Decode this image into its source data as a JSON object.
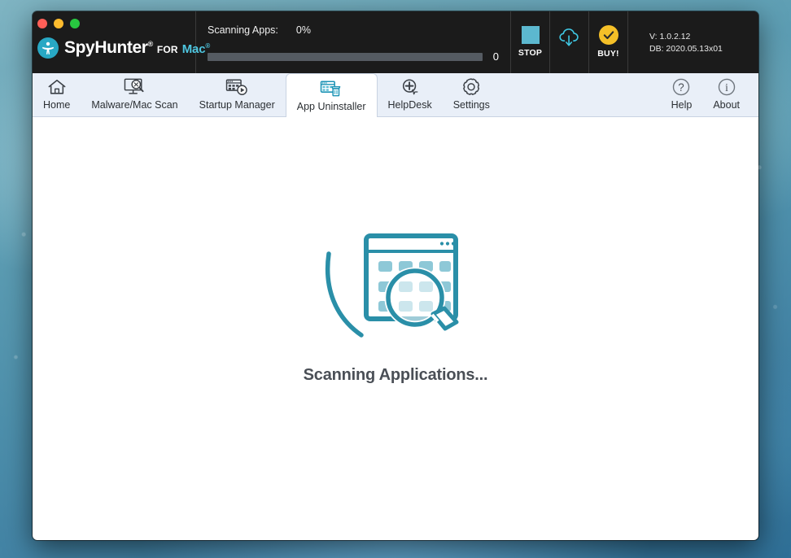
{
  "window": {
    "traffic_lights": [
      "close",
      "minimize",
      "zoom"
    ]
  },
  "brand": {
    "name": "SpyHunter",
    "registered_mark": "®",
    "for_word": "FOR",
    "platform": "Mac",
    "platform_mark": "®"
  },
  "scan": {
    "label": "Scanning Apps:",
    "percent": "0%",
    "progress_value": 0,
    "count": "0"
  },
  "actions": {
    "stop_label": "STOP",
    "update_label": "",
    "buy_label": "BUY!"
  },
  "version": {
    "app": "V:  1.0.2.12",
    "database": "DB:  2020.05.13x01"
  },
  "tabs": {
    "left": [
      {
        "label": "Home",
        "icon": "home-icon",
        "active": false
      },
      {
        "label": "Malware/Mac Scan",
        "icon": "malware-scan-icon",
        "active": false
      },
      {
        "label": "Startup Manager",
        "icon": "startup-manager-icon",
        "active": false
      },
      {
        "label": "App Uninstaller",
        "icon": "app-uninstaller-icon",
        "active": true
      },
      {
        "label": "HelpDesk",
        "icon": "helpdesk-icon",
        "active": false
      },
      {
        "label": "Settings",
        "icon": "settings-gear-icon",
        "active": false
      }
    ],
    "right": [
      {
        "label": "Help",
        "icon": "help-question-icon"
      },
      {
        "label": "About",
        "icon": "about-info-icon"
      }
    ]
  },
  "main": {
    "status_text": "Scanning Applications...",
    "illustration": "app-scan-magnifier-icon"
  },
  "colors": {
    "accent_teal": "#2a8fa8",
    "accent_light_teal": "#4ec6e0",
    "buy_yellow": "#f5c028",
    "toolbar_dark": "#1b1b1b",
    "tabbar_bg": "#e9eff8",
    "status_text": "#4a4f56"
  }
}
